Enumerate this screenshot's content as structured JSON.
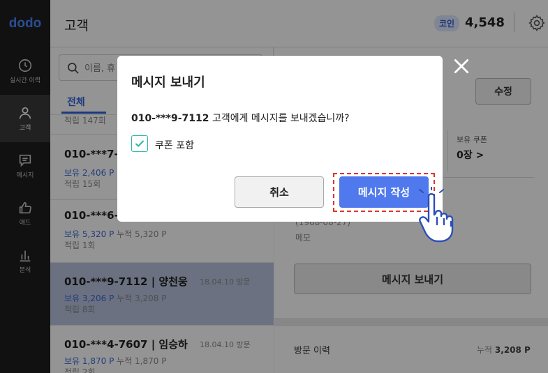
{
  "app": {
    "logo": "dodo",
    "brand_color": "#4a86ff"
  },
  "sidebar": {
    "items": [
      {
        "label": "실시간 이력",
        "icon": "clock-icon",
        "active": false
      },
      {
        "label": "고객",
        "icon": "person-icon",
        "active": true
      },
      {
        "label": "메시지",
        "icon": "message-icon",
        "active": false
      },
      {
        "label": "애드",
        "icon": "thumbs-up-icon",
        "active": false
      },
      {
        "label": "분석",
        "icon": "bar-chart-icon",
        "active": false
      }
    ]
  },
  "header": {
    "title": "고객",
    "coin_badge": "코인",
    "coin_value": "4,548",
    "settings_icon": "gear-icon"
  },
  "list": {
    "search_placeholder": "이름, 휴",
    "tab_all": "전체",
    "rows": [
      {
        "phone": "",
        "date": "",
        "balance": "",
        "balance_suffix": "",
        "count": "적립 147회"
      },
      {
        "phone": "010-***7-",
        "date": "",
        "balance": "보유 2,406 P",
        "balance_suffix": "",
        "count": "적립 15회"
      },
      {
        "phone": "010-***6-",
        "date": "",
        "balance": "보유 5,320 P",
        "balance_suffix": "누적 5,320 P",
        "count": "적립 1회"
      },
      {
        "phone": "010-***9-7112 | 양천웅",
        "date": "18.04.10 방문",
        "balance": "보유 3,206 P",
        "balance_suffix": "누적 3,208 P",
        "count": "적립 8회"
      },
      {
        "phone": "010-***4-7607 | 임승하",
        "date": "18.04.10 방문",
        "balance": "보유 1,870 P",
        "balance_suffix": "누적 1,870 P",
        "count": "적립 2회"
      }
    ]
  },
  "detail": {
    "edit_label": "수정",
    "coupon_label": "보유 쿠폰",
    "coupon_count": "0장 >",
    "birth_text": "(1968-08-27)",
    "memo_label": "메모",
    "send_label": "메시지 보내기",
    "visit_label": "방문 이력",
    "visit_total_prefix": "누적",
    "visit_total_value": "3,208 P"
  },
  "modal": {
    "title": "메시지 보내기",
    "msg_phone": "010-***9-7112",
    "msg_rest": " 고객에게 메시지를 보내겠습니까?",
    "checkbox_label": "쿠폰 포함",
    "checkbox_checked": true,
    "cancel_label": "취소",
    "confirm_label": "메시지 작성",
    "accent_color": "#4f79ec",
    "highlight_color": "#d8382e"
  }
}
